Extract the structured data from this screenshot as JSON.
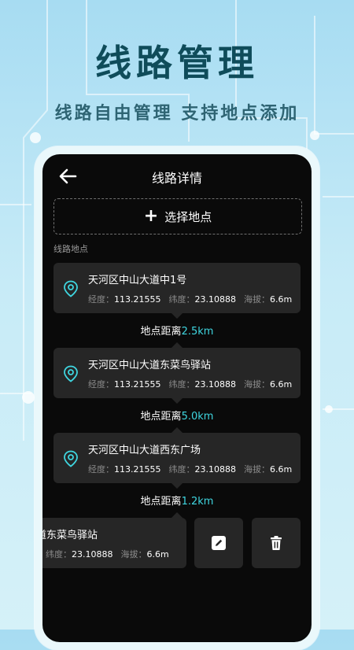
{
  "hero": {
    "title": "线路管理",
    "subtitle": "线路自由管理  支持地点添加"
  },
  "screen": {
    "title": "线路详情",
    "add_location_label": "选择地点",
    "section_label": "线路地点"
  },
  "labels": {
    "lon": "经度：",
    "lat": "纬度：",
    "alt": "海拔：",
    "distance_prefix": "地点距离"
  },
  "locations": [
    {
      "name": "天河区中山大道中1号",
      "lon": "113.21555",
      "lat": "23.10888",
      "alt": "6.6m"
    },
    {
      "name": "天河区中山大道东菜鸟驿站",
      "lon": "113.21555",
      "lat": "23.10888",
      "alt": "6.6m"
    },
    {
      "name": "天河区中山大道西东广场",
      "lon": "113.21555",
      "lat": "23.10888",
      "alt": "6.6m"
    }
  ],
  "distances": [
    "2.5km",
    "5.0km",
    "1.2km"
  ],
  "swiped_item": {
    "name": "道东菜鸟驿站",
    "lat": "23.10888",
    "alt": "6.6m"
  },
  "colors": {
    "accent": "#3fd6e0",
    "card": "#262626",
    "screen_bg": "#0a0a0a",
    "hero_text": "#0f4c5a"
  },
  "icons": {
    "back": "arrow-left-icon",
    "add": "plus-icon",
    "location": "map-pin-icon",
    "edit": "edit-icon",
    "delete": "trash-icon"
  }
}
